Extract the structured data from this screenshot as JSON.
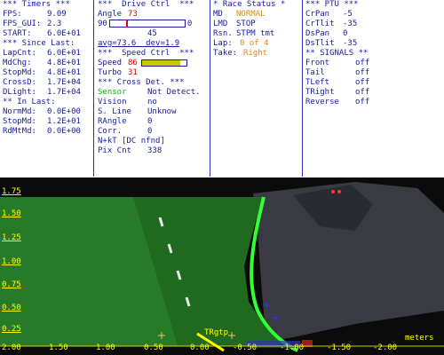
{
  "timers": {
    "title": "*** Timers ***",
    "fps_label": "FPS:",
    "fps": "9.09",
    "fpsgui_label": "FPS_GUI:",
    "fpsgui": "2.3",
    "start_label": "START:",
    "start": "6.0E+01",
    "since_title": "*** Since Last:",
    "lapcnt_label": "LapCnt:",
    "lapcnt": "6.0E+01",
    "mdchg_label": "MdChg:",
    "mdchg": "4.8E+01",
    "stopmd_label": "StopMd:",
    "stopmd": "4.8E+01",
    "crossd_label": "CrossD:",
    "crossd": "1.7E+04",
    "dlight_label": "DLight:",
    "dlight": "1.7E+04",
    "in_title": "** In Last:",
    "normmd_label": "NormMd:",
    "normmd": "0.0E+00",
    "stopmd2_label": "StopMd:",
    "stopmd2": "1.2E+01",
    "rdmtmd_label": "RdMtMd:",
    "rdmtmd": "0.0E+00"
  },
  "drive": {
    "title": "***  Drive Ctrl  ***",
    "angle_label": "Angle",
    "angle": "73",
    "slider_min": "90",
    "slider_max": "0",
    "slider_level": 0.19,
    "slider_mid": "45",
    "avg": "avg=73.6  dev=1.9",
    "speed_title": "***  Speed Ctrl  ***",
    "speed_label": "Speed",
    "speed": "86",
    "speed_level": 0.86,
    "turbo_label": "Turbo",
    "turbo": "31",
    "cross_title": "*** Cross Det. ***",
    "sensor_label": "Sensor",
    "sensor": "Not Detect.",
    "vision_label": "Vision",
    "vision": "no",
    "sline_label": "S. Line",
    "sline": "Unknow",
    "rangle_label": "RAngle",
    "rangle": "0",
    "corr_label": "Corr.",
    "corr": "0",
    "nkt": "N+kT [DC nfnd]",
    "pix_label": "Pix Cnt",
    "pix": "338"
  },
  "race": {
    "title": "* Race Status *",
    "md_label": "MD",
    "md": "NORMAL",
    "lmd_label": "LMD",
    "lmd": "STOP",
    "rsn_label": "Rsn.",
    "rsn": "STPM tmt",
    "lap_label": "Lap:",
    "lap": "0 of 4",
    "take_label": "Take:",
    "take": "Right"
  },
  "ptu": {
    "title": "*** PTU ***",
    "crpan_label": "CrPan",
    "crpan": "-5",
    "crtilt_label": "CrTlit",
    "crtilt": "-35",
    "dspan_label": "DsPan",
    "dspan": "0",
    "dstilt_label": "DsTlit",
    "dstilt": "-35",
    "signals_title": "** SIGNALS **",
    "front_label": "Front",
    "front": "off",
    "tail_label": "Tail",
    "tail": "off",
    "tleft_label": "TLeft",
    "tleft": "off",
    "tright_label": "TRight",
    "tright": "off",
    "reverse_label": "Reverse",
    "reverse": "off"
  },
  "view": {
    "y_ticks": [
      "1.75",
      "1.50",
      "1.25",
      "1.00",
      "0.75",
      "0.50",
      "0.25"
    ],
    "x_ticks": [
      "2.00",
      "1.50",
      "1.00",
      "0.50",
      "0.00",
      "-0.50",
      "-1.00",
      "-1.50",
      "-2.00"
    ],
    "units": "meters",
    "target_label": "TRgtp"
  }
}
